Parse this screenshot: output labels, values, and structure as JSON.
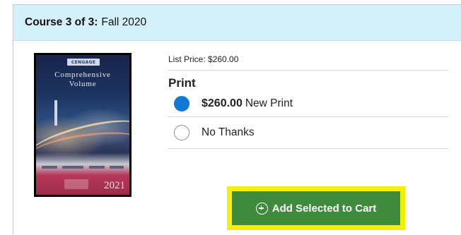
{
  "course": {
    "label": "Course 3 of 3:",
    "term": "Fall 2020"
  },
  "book": {
    "publisher_badge": "CENGAGE",
    "cover_title_line1": "Comprehensive",
    "cover_title_line2": "Volume",
    "cover_year": "2021"
  },
  "pricing": {
    "list_price": "List Price: $260.00",
    "format_heading": "Print",
    "options": [
      {
        "price": "$260.00",
        "type": "New Print",
        "selected": true
      },
      {
        "label": "No Thanks",
        "selected": false
      }
    ]
  },
  "actions": {
    "add_to_cart_label": "Add Selected to Cart"
  },
  "colors": {
    "header_bg": "#d4f1fb",
    "radio_selected": "#1378d1",
    "button_bg": "#3f8a3d",
    "highlight": "#f5f000"
  }
}
